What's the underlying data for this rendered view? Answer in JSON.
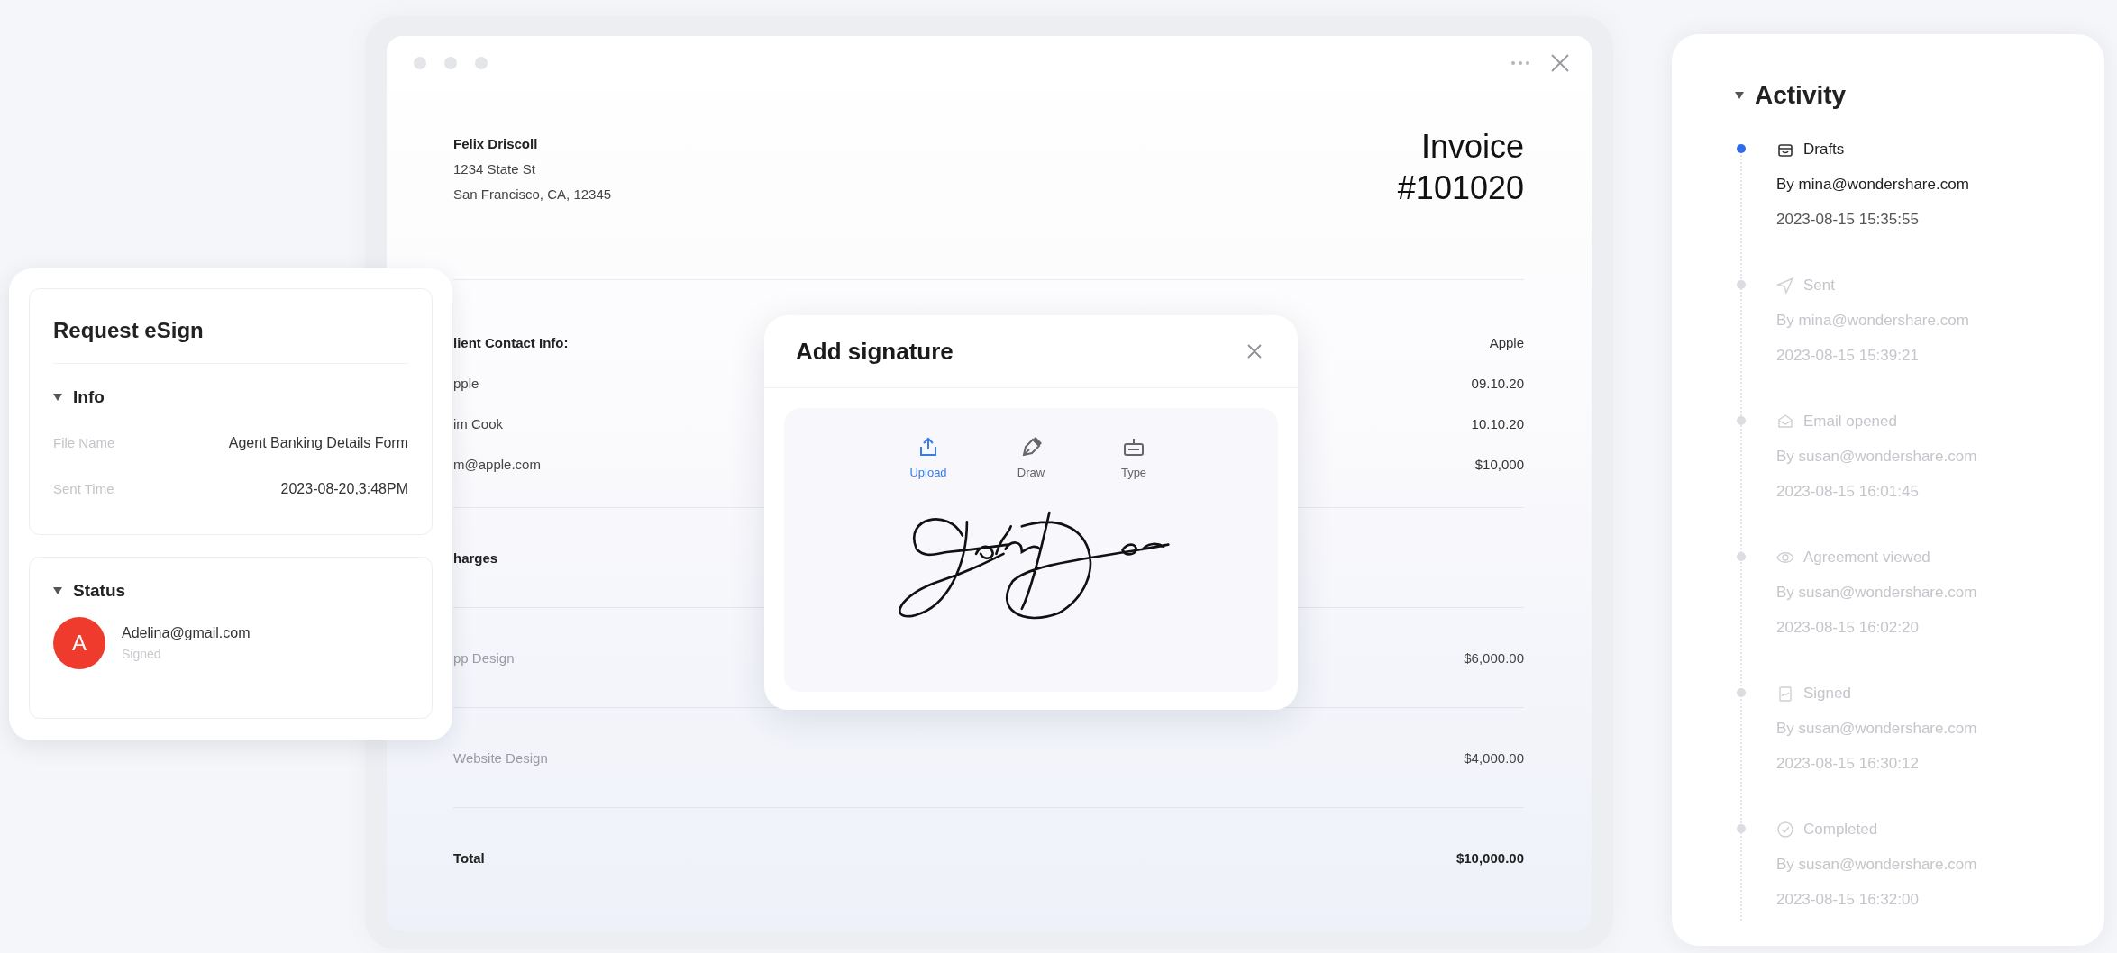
{
  "invoice_window": {
    "sender": {
      "name": "Felix Driscoll",
      "street": "1234 State St",
      "city": "San Francisco, CA, 12345"
    },
    "title": "Invoice",
    "number": "#101020",
    "contact_rows": [
      {
        "label": "lient Contact Info:",
        "value": "Apple"
      },
      {
        "label": "pple",
        "value": "09.10.20"
      },
      {
        "label": "im Cook",
        "value": "10.10.20"
      },
      {
        "label": "m@apple.com",
        "value": "$10,000"
      }
    ],
    "charges_heading": "harges",
    "charge_rows": [
      {
        "label": "pp Design",
        "amount": "$6,000.00"
      },
      {
        "label": "Website Design",
        "amount": "$4,000.00"
      }
    ],
    "total": {
      "label": "Total",
      "amount": "$10,000.00"
    }
  },
  "esign_panel": {
    "title": "Request eSign",
    "info": {
      "heading": "Info",
      "expanded": true,
      "fields": [
        {
          "label": "File Name",
          "value": "Agent Banking Details Form"
        },
        {
          "label": "Sent Time",
          "value": "2023-08-20,3:48PM"
        }
      ]
    },
    "status": {
      "heading": "Status",
      "expanded": true,
      "signer": {
        "initial": "A",
        "email": "Adelina@gmail.com",
        "state": "Signed"
      }
    }
  },
  "signature_dialog": {
    "title": "Add signature",
    "tabs": [
      {
        "label": "Upload",
        "selected": true
      },
      {
        "label": "Draw",
        "selected": false
      },
      {
        "label": "Type",
        "selected": false
      }
    ]
  },
  "activity": {
    "heading": "Activity",
    "expanded": true,
    "events": [
      {
        "label": "Drafts",
        "by": "By mina@wondershare.com",
        "time": "2023-08-15 15:35:55",
        "active": true
      },
      {
        "label": "Sent",
        "by": "By mina@wondershare.com",
        "time": "2023-08-15 15:39:21",
        "active": false
      },
      {
        "label": "Email opened",
        "by": "By susan@wondershare.com",
        "time": "2023-08-15 16:01:45",
        "active": false
      },
      {
        "label": "Agreement viewed",
        "by": "By susan@wondershare.com",
        "time": "2023-08-15 16:02:20",
        "active": false
      },
      {
        "label": "Signed",
        "by": "By susan@wondershare.com",
        "time": "2023-08-15 16:30:12",
        "active": false
      },
      {
        "label": "Completed",
        "by": "By susan@wondershare.com",
        "time": "2023-08-15 16:32:00",
        "active": false
      }
    ]
  }
}
